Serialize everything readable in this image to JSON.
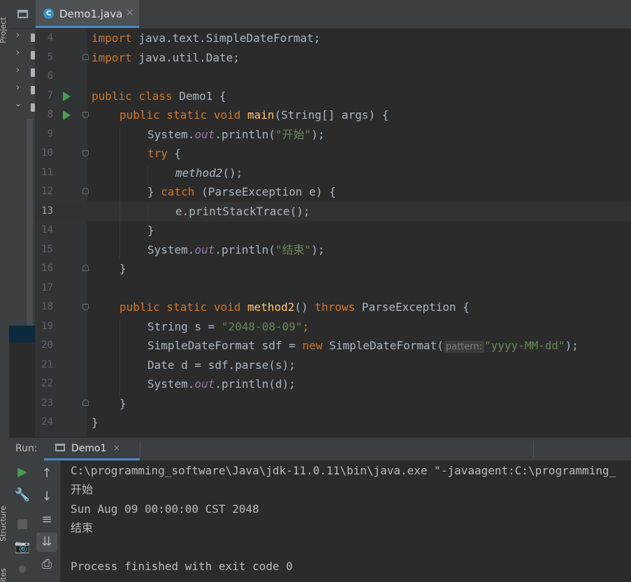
{
  "tool_window": {
    "project_label": "Project",
    "structure_label": "Structure",
    "favorites_label": "ites"
  },
  "editor_tab": {
    "icon_letter": "C",
    "title": "Demo1.java",
    "close": "×"
  },
  "gutter": {
    "lines": [
      "4",
      "5",
      "6",
      "7",
      "8",
      "9",
      "10",
      "11",
      "12",
      "13",
      "14",
      "15",
      "16",
      "17",
      "18",
      "19",
      "20",
      "21",
      "22",
      "23",
      "24"
    ],
    "current_line": "13"
  },
  "code": {
    "l4": {
      "kw": "import",
      "rest": " java.text.SimpleDateFormat;"
    },
    "l5": {
      "kw": "import",
      "rest": " java.util.Date;"
    },
    "l7": {
      "kw": "public class",
      "rest": " Demo1 {"
    },
    "l8": {
      "kw": "public static void",
      "fn": "main",
      "rest": "(String[] args) {"
    },
    "l9": {
      "a": "System.",
      "fld": "out",
      "b": ".println(",
      "str": "\"开始\"",
      "c": ");"
    },
    "l10": {
      "kw": "try",
      "rest": " {"
    },
    "l11": {
      "call": "method2",
      "rest": "();"
    },
    "l12": {
      "a": "} ",
      "kw": "catch",
      "rest": " (ParseException e) {"
    },
    "l13": {
      "text": "e.printStackTrace();"
    },
    "l14": {
      "text": "}"
    },
    "l15": {
      "a": "System.",
      "fld": "out",
      "b": ".println(",
      "str": "\"结束\"",
      "c": ");"
    },
    "l16": {
      "text": "}"
    },
    "l18": {
      "kw": "public static void",
      "fn": "method2",
      "mid": "() ",
      "kw2": "throws",
      "rest": " ParseException {"
    },
    "l19": {
      "a": "String s = ",
      "str": "\"2048-08-09\"",
      "c": ";"
    },
    "l20": {
      "a": "SimpleDateFormat sdf = ",
      "kw": "new",
      "b": " SimpleDateFormat(",
      "hint": "pattern:",
      "str": "\"yyyy-MM-dd\"",
      "c": ");"
    },
    "l21": {
      "text": "Date d = sdf.parse(s);"
    },
    "l22": {
      "a": "System.",
      "fld": "out",
      "b": ".println(d);"
    },
    "l23": {
      "text": "}"
    },
    "l24": {
      "text": "}"
    }
  },
  "run_panel": {
    "label": "Run:",
    "tab_title": "Demo1",
    "tab_close": "×",
    "output": [
      "C:\\programming_software\\Java\\jdk-11.0.11\\bin\\java.exe \"-javaagent:C:\\programming_",
      "开始",
      "Sun Aug 09 00:00:00 CST 2048",
      "结束",
      "",
      "Process finished with exit code 0"
    ]
  },
  "colors": {
    "keyword": "#cc7832",
    "function": "#ffc66d",
    "string": "#6a8759",
    "static_field": "#9876aa",
    "text": "#a9b7c6",
    "run_green": "#499c54",
    "accent": "#4a88c7"
  },
  "icons": [
    "project-icon",
    "class-c-icon",
    "run-gutter-icon",
    "fold-icon",
    "rerun-icon",
    "wrench-icon",
    "stop-icon",
    "camera-icon",
    "bug-icon",
    "up-arrow-icon",
    "down-arrow-icon",
    "soft-wrap-icon",
    "scroll-to-end-icon",
    "print-icon"
  ]
}
